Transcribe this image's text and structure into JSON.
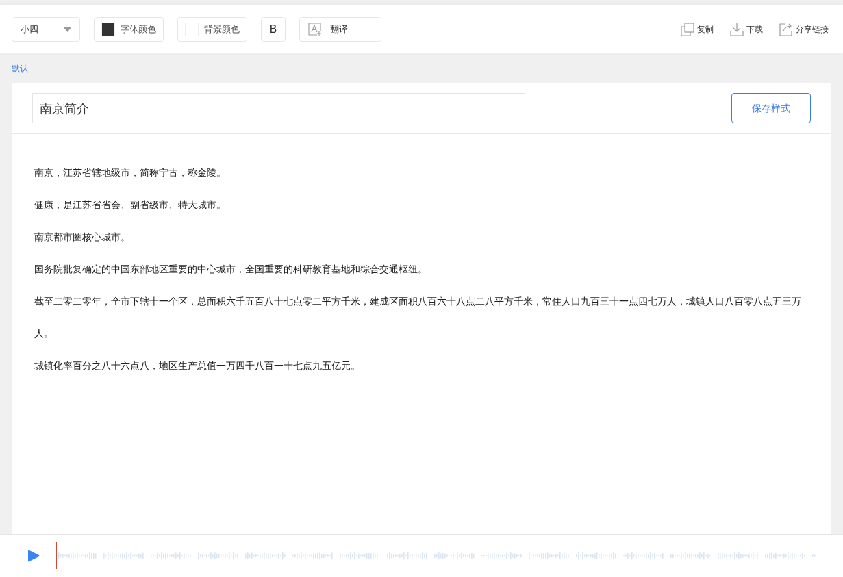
{
  "toolbar": {
    "font_size": {
      "value": "小四"
    },
    "tools": [
      {
        "kind": "swatch",
        "label": "字体颜色",
        "color": "#333333"
      },
      {
        "kind": "swatch",
        "label": "背景颜色",
        "color": "#ffffff"
      },
      {
        "kind": "bold",
        "label": "B"
      },
      {
        "kind": "translate",
        "label": "翻译"
      }
    ],
    "actions": [
      {
        "kind": "copy",
        "label": "复制"
      },
      {
        "kind": "download",
        "label": "下载"
      },
      {
        "kind": "share",
        "label": "分享链接"
      }
    ]
  },
  "style_link": "默认",
  "document": {
    "title": "南京简介",
    "save_button": "保存样式",
    "paragraphs": [
      "南京，江苏省辖地级市，简称宁古，称金陵。",
      "健康，是江苏省省会、副省级市、特大城市。",
      "南京都市圈核心城市。",
      "国务院批复确定的中国东部地区重要的中心城市，全国重要的科研教育基地和综合交通枢纽。",
      "截至二零二零年，全市下辖十一个区，总面积六千五百八十七点零二平方千米，建成区面积八百六十八点二八平方千米，常住人口九百三十一点四七万人，城镇人口八百零八点五三万人。",
      "城镇化率百分之八十六点八，地区生产总值一万四千八百一十七点九五亿元。"
    ]
  },
  "player": {
    "level": 0
  }
}
